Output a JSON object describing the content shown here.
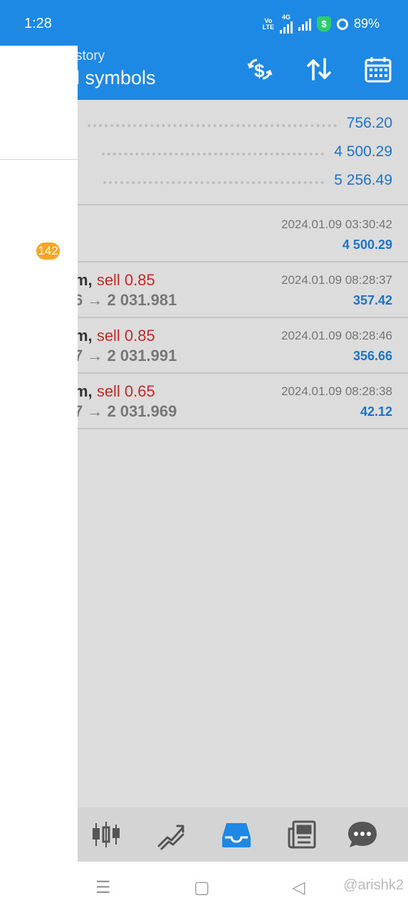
{
  "status": {
    "time": "1:28",
    "volte_top": "Vo",
    "volte_bottom": "LTE",
    "network": "4G",
    "battery": "89%"
  },
  "header": {
    "title_top": "story",
    "title_main": "ll symbols",
    "icons": [
      "currency-exchange-icon",
      "sort-icon",
      "calendar-icon"
    ]
  },
  "summary": {
    "rows": [
      "756.20",
      "4 500.29",
      "5 256.49"
    ]
  },
  "deposit": {
    "time": "2024.01.09 03:30:42",
    "amount": "4 500.29"
  },
  "deals": [
    {
      "symbol_tail": "m,",
      "side": "sell 0.85",
      "prices": "6 → 2 031.981",
      "time": "2024.01.09 08:28:37",
      "profit": "357.42"
    },
    {
      "symbol_tail": "m,",
      "side": "sell 0.85",
      "prices": "7 → 2 031.991",
      "time": "2024.01.09 08:28:46",
      "profit": "356.66"
    },
    {
      "symbol_tail": "m,",
      "side": "sell 0.65",
      "prices": "7 → 2 031.969",
      "time": "2024.01.09 08:28:38",
      "profit": "42.12"
    }
  ],
  "drawer": {
    "badge": "142"
  },
  "bottom_nav": {
    "items": [
      "quotes-icon",
      "chart-icon",
      "history-icon",
      "news-icon",
      "chat-icon"
    ],
    "active": "history-icon",
    "active_color": "#1e88e5"
  },
  "watermark": "@arishk2",
  "colors": {
    "accent": "#1e88e5",
    "sell": "#c62828",
    "value": "#1e73c7",
    "badge": "#f5a623"
  }
}
